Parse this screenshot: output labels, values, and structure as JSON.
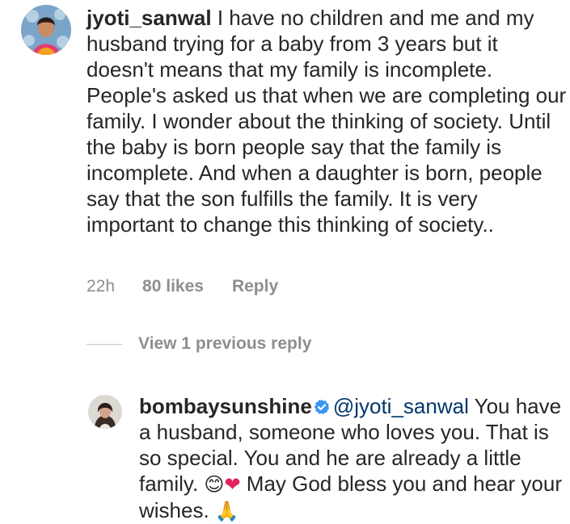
{
  "comment1": {
    "username": "jyoti_sanwal",
    "text": " I have no children and me and my husband trying for a baby from 3 years but it doesn't means that my family is incomplete. People's asked us that when we are completing our family. I wonder about the thinking of society. Until the baby is born people say that the family is incomplete. And when a daughter is born, people say that the son fulfills the family. It is very important to change this thinking of society..",
    "time": "22h",
    "likes": "80 likes",
    "reply_label": "Reply"
  },
  "view_replies": {
    "label": "View 1 previous reply"
  },
  "comment2": {
    "username": "bombaysunshine",
    "verified_icon": "verified-badge-icon",
    "mention": "@jyoti_sanwal",
    "text_part1": " You have a husband, someone who loves you. That is so special. You and he are already a little family. ",
    "emoji1": "😊",
    "emoji2": "❤",
    "text_part2": " May God bless you and hear your wishes. ",
    "emoji3": "🙏"
  },
  "colors": {
    "text": "#262626",
    "secondary": "#8e8e8e",
    "mention": "#00376b",
    "verified": "#3897f0"
  }
}
